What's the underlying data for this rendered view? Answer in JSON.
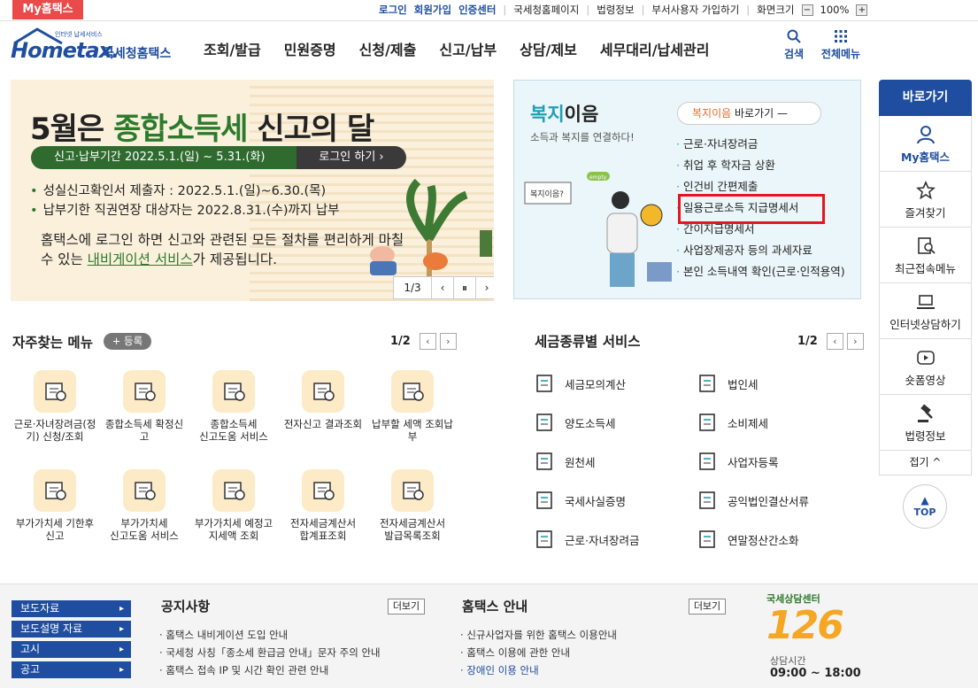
{
  "util": {
    "myhome": "My홈택스",
    "login": "로그인",
    "join": "회원가입",
    "cert": "인증센터",
    "nts": "국세청홈페이지",
    "law": "법령정보",
    "dept": "부서사용자 가입하기",
    "screen": "화면크기",
    "zoom": "100%",
    "minus": "−",
    "plus": "+"
  },
  "header": {
    "logo_small": "인터넷 납세서비스",
    "logo_main": "Hometax.",
    "logo_kr": "국세청홈택스",
    "search": "검색",
    "allmenu": "전체메뉴"
  },
  "gnb": [
    "조회/발급",
    "민원증명",
    "신청/제출",
    "신고/납부",
    "상담/제보",
    "세무대리/납세관리"
  ],
  "banner": {
    "title_a": "5월은 ",
    "title_b": "종합소득세",
    "title_c": " 신고의 달",
    "period": "신고·납부기간  2022.5.1.(일) ~ 5.31.(화)",
    "login": "로그인 하기  ›",
    "bullets": [
      "성실신고확인서 제출자 : 2022.5.1.(일)~6.30.(목)",
      "납부기한 직권연장 대상자는 2022.8.31.(수)까지 납부"
    ],
    "desc_a": "홈택스에 로그인 하면 신고와 관련된 모든 절차를 편리하게 마칠 수 있는 ",
    "desc_link": "내비게이션 서비스",
    "desc_b": "가 제공됩니다.",
    "page": "1/3"
  },
  "welfare": {
    "title_a": "복지",
    "title_b": "이음",
    "sub": "소득과 복지를 연결하다!",
    "go_a": "복지이음",
    "go_b": " 바로가기",
    "items": [
      "근로·자녀장려금",
      "취업 후 학자금 상환",
      "인건비 간편제출",
      "일용근로소득 지급명세서",
      "간이지급명세서",
      "사업장제공자 등의 과세자료",
      "본인 소득내역 확인(근로·인적용역)"
    ],
    "sign": "복지이음?",
    "tag": "empty"
  },
  "quick": {
    "title": "바로가기",
    "items": [
      "My홈택스",
      "즐겨찾기",
      "최근접속메뉴",
      "인터넷상담하기",
      "숏폼영상",
      "법령정보"
    ],
    "fold": "접기 ^",
    "top": "TOP"
  },
  "freq": {
    "title": "자주찾는 메뉴",
    "add": "+ 등록",
    "page": "1/2",
    "items": [
      [
        "근로·자녀장려금(정",
        "기) 신청/조회"
      ],
      [
        "종합소득세 확정신",
        "고"
      ],
      [
        "종합소득세",
        "신고도움 서비스"
      ],
      [
        "전자신고 결과조회",
        ""
      ],
      [
        "납부할 세액 조회납",
        "부"
      ],
      [
        "부가가치세 기한후",
        "신고"
      ],
      [
        "부가가치세",
        "신고도움 서비스"
      ],
      [
        "부가가치세 예정고",
        "지세액 조회"
      ],
      [
        "전자세금계산서",
        "합계표조회"
      ],
      [
        "전자세금계산서",
        "발급목록조회"
      ]
    ]
  },
  "taxsvc": {
    "title": "세금종류별 서비스",
    "page": "1/2",
    "left": [
      "세금모의계산",
      "양도소득세",
      "원천세",
      "국세사실증명",
      "근로·자녀장려금"
    ],
    "right": [
      "법인세",
      "소비제세",
      "사업자등록",
      "공익법인결산서류",
      "연말정산간소화"
    ]
  },
  "footer": {
    "btns": [
      "보도자료",
      "보도설명 자료",
      "고시",
      "공고"
    ],
    "notice_title": "공지사항",
    "more": "더보기",
    "notices": [
      "홈택스 내비게이션 도입 안내",
      "국세청 사칭「종소세 환급금 안내」문자 주의 안내",
      "홈택스 접속 IP 및 시간 확인 관련 안내"
    ],
    "guide_title": "홈택스 안내",
    "guides": [
      "신규사업자를 위한 홈택스 이용안내",
      "홈택스 이용에 관한 안내",
      "장애인 이용 안내"
    ],
    "center": "국세상담센터",
    "number": "126",
    "hours_label": "상담시간",
    "hours": "09:00 ~ 18:00"
  }
}
